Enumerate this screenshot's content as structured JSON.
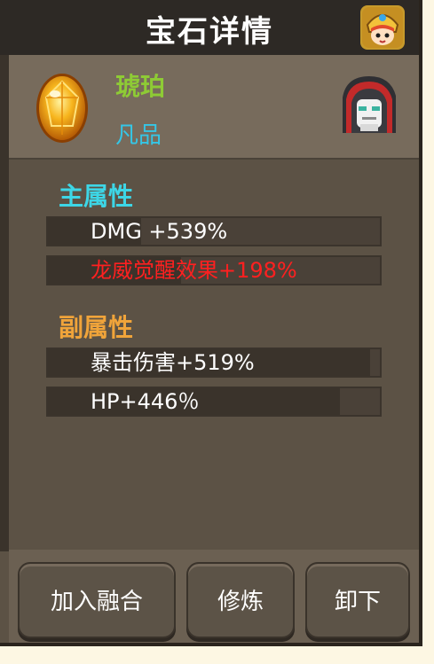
{
  "header": {
    "title": "宝石详情"
  },
  "gem": {
    "name": "琥珀",
    "grade": "凡品"
  },
  "main_attr": {
    "title": "主属性",
    "items": [
      {
        "text": "DMG +539%",
        "color": "#ffffff",
        "fill": 0.28
      },
      {
        "text": "龙威觉醒效果+198%",
        "color": "#ff2020",
        "fill": 0.4
      }
    ]
  },
  "sub_attr": {
    "title": "副属性",
    "items": [
      {
        "text": "暴击伤害+519%",
        "color": "#ffffff",
        "fill": 0.97
      },
      {
        "text": "HP+446％",
        "color": "#ffffff",
        "fill": 0.88
      }
    ]
  },
  "buttons": {
    "merge": "加入融合",
    "refine": "修炼",
    "unequip": "卸下"
  },
  "colors": {
    "main_title": "#3dd6e6",
    "sub_title": "#f0a43a",
    "gem_name": "#8ecb35",
    "grade": "#35c6e6"
  },
  "icons": {
    "avatar": "hero-avatar-icon",
    "gem": "amber-gem-icon",
    "socket": "hooded-robot-icon"
  }
}
